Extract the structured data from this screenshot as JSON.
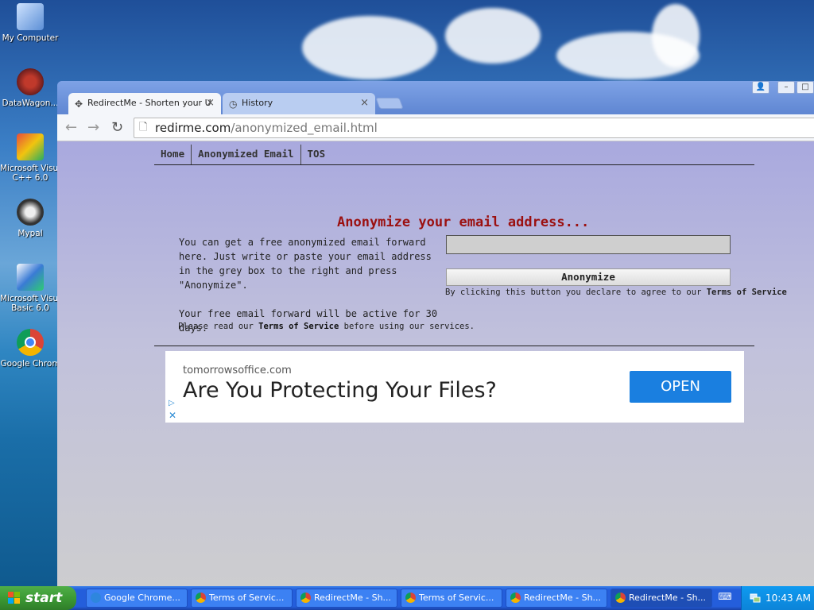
{
  "desktop": {
    "icons": [
      {
        "label": "My Computer",
        "icon": "my-computer-icon"
      },
      {
        "label": "DataWagon...",
        "icon": "datawagon-icon"
      },
      {
        "label": "Microsoft Visual C++ 6.0",
        "line1": "Microsoft Visua",
        "line2": "C++ 6.0",
        "icon": "visual-cpp-icon"
      },
      {
        "label": "Mypal",
        "icon": "mypal-icon"
      },
      {
        "label": "Microsoft Visual Basic 6.0",
        "line1": "Microsoft Visua",
        "line2": "Basic 6.0",
        "icon": "visual-basic-icon"
      },
      {
        "label": "Google Chrom",
        "icon": "google-chrome-icon"
      }
    ]
  },
  "browser": {
    "tabs": [
      {
        "label": "RedirectMe - Shorten your U",
        "icon": "redirectme-favicon",
        "active": true
      },
      {
        "label": "History",
        "icon": "history-icon",
        "active": false
      }
    ],
    "url_host": "redirme.com",
    "url_path": "/anonymized_email.html"
  },
  "page": {
    "nav": [
      "Home",
      "Anonymized Email",
      "TOS"
    ],
    "headline": "Anonymize your email address...",
    "desc_p1": "You can get a free anonymized email forward here. Just write or paste your email address in the grey box to the right and press \"Anonymize\".",
    "desc_p2": "Your free email forward will be active for 30 days.",
    "read_prefix": "Please read our ",
    "read_link": "Terms of Service",
    "read_suffix": " before using our services.",
    "email_value": "",
    "button_label": "Anonymize",
    "agree_prefix": "By clicking this button you declare to agree to our ",
    "agree_link": "Terms of Service"
  },
  "ad": {
    "domain": "tomorrowsoffice.com",
    "headline": "Are You Protecting Your Files?",
    "cta": "OPEN"
  },
  "taskbar": {
    "start_label": "start",
    "tasks": [
      {
        "label": "Google Chrome...",
        "icon": "ie-icon"
      },
      {
        "label": "Terms of Servic...",
        "icon": "chrome-icon"
      },
      {
        "label": "RedirectMe - Sh...",
        "icon": "chrome-icon"
      },
      {
        "label": "Terms of Servic...",
        "icon": "chrome-icon"
      },
      {
        "label": "RedirectMe - Sh...",
        "icon": "chrome-icon"
      },
      {
        "label": "RedirectMe - Sh...",
        "icon": "chrome-icon",
        "active": true
      }
    ],
    "clock": "10:43 AM"
  },
  "colors": {
    "headline": "#9b1010",
    "cta": "#1a7fe0",
    "taskbar": "#245edb",
    "start": "#3c9a34"
  }
}
